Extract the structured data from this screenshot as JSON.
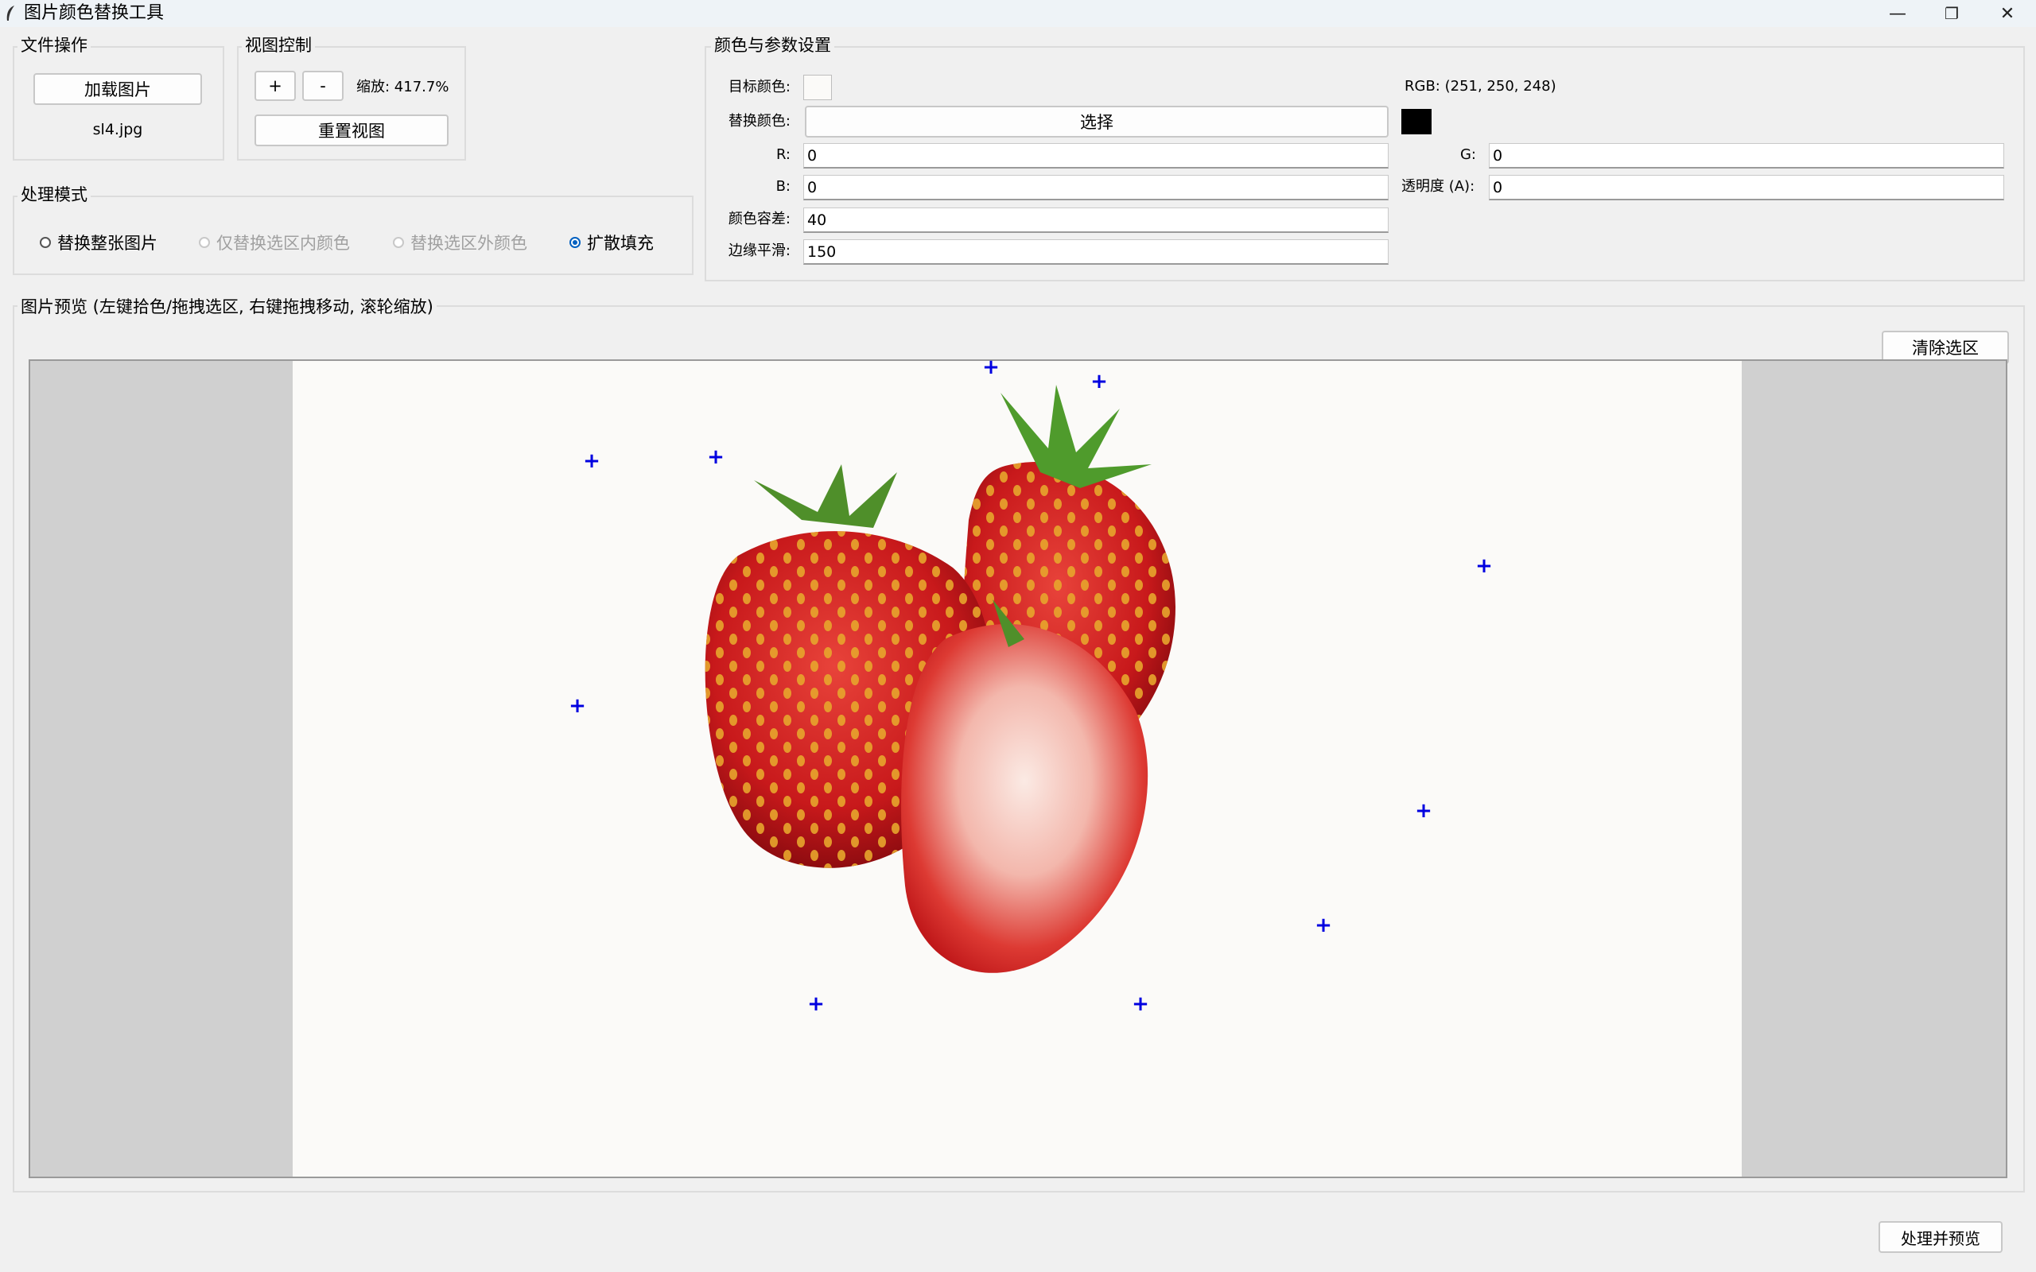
{
  "window": {
    "title": "图片颜色替换工具",
    "controls": {
      "minimize": "—",
      "restore": "❐",
      "close": "✕"
    }
  },
  "file_ops": {
    "group_label": "文件操作",
    "load_button": "加载图片",
    "filename": "sl4.jpg"
  },
  "view_ctrl": {
    "group_label": "视图控制",
    "zoom_in": "+",
    "zoom_out": "-",
    "zoom_text": "缩放: 417.7%",
    "reset_button": "重置视图"
  },
  "mode": {
    "group_label": "处理模式",
    "options": [
      {
        "label": "替换整张图片",
        "enabled": true,
        "checked": false
      },
      {
        "label": "仅替换选区内颜色",
        "enabled": false,
        "checked": false
      },
      {
        "label": "替换选区外颜色",
        "enabled": false,
        "checked": false
      },
      {
        "label": "扩散填充",
        "enabled": true,
        "checked": true
      }
    ]
  },
  "params": {
    "group_label": "颜色与参数设置",
    "target_color_label": "目标颜色:",
    "target_color": "#fbfaf8",
    "target_rgb_text": "RGB: (251, 250, 248)",
    "replace_color_label": "替换颜色:",
    "select_button": "选择",
    "replace_color": "#000000",
    "r_label": "R:",
    "r_value": "0",
    "g_label": "G:",
    "g_value": "0",
    "b_label": "B:",
    "b_value": "0",
    "a_label": "透明度 (A):",
    "a_value": "0",
    "tolerance_label": "颜色容差:",
    "tolerance_value": "40",
    "smooth_label": "边缘平滑:",
    "smooth_value": "150"
  },
  "preview": {
    "group_label": "图片预览 (左键拾色/拖拽选区, 右键拖拽移动, 滚轮缩放)",
    "clear_button": "清除选区",
    "image_bg": "#fbfaf8",
    "canvas_bg": "#d0d0d0",
    "marker_glyph": "+",
    "marker_color": "#0000e0"
  },
  "footer": {
    "process_button": "处理并预览"
  }
}
